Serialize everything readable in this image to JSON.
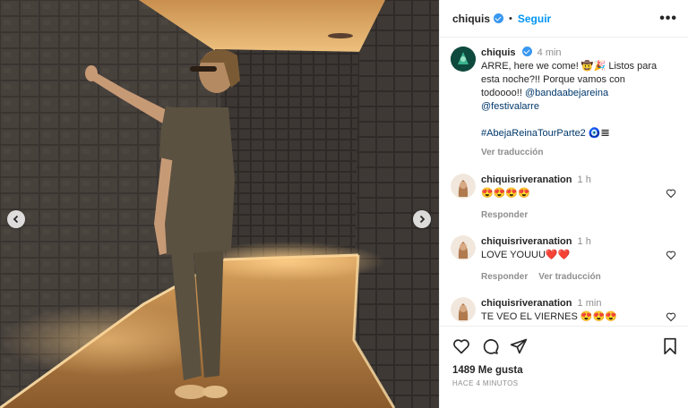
{
  "post": {
    "author": "chiquis",
    "follow_label": "Seguir",
    "more_label": "•••"
  },
  "caption": {
    "user": "chiquis",
    "time": "4 min",
    "text": "ARRE, here we come! 🤠🎉 Listos para esta noche?!! Porque vamos con todoooo!!",
    "mentions": [
      "@bandaabejareina",
      "@festivalarre"
    ],
    "hashtag": "#AbejaReinaTourParte2",
    "hashtag_emoji": "🧿𝌆",
    "translate_label": "Ver traducción"
  },
  "comments": [
    {
      "user": "chiquisriveranation",
      "time": "1 h",
      "text": "😍😍😍😍",
      "actions": [
        "Responder"
      ]
    },
    {
      "user": "chiquisriveranation",
      "time": "1 h",
      "text": "LOVE YOUUU❤️❤️",
      "actions": [
        "Responder",
        "Ver traducción"
      ]
    },
    {
      "user": "chiquisriveranation",
      "time": "1 min",
      "text": "TE VEO EL VIERNES 😍😍😍",
      "actions": []
    }
  ],
  "stats": {
    "likes": "1489 Me gusta",
    "time_ago": "HACE 4 MINUTOS"
  },
  "icons": {
    "like": "heart-icon",
    "comment": "comment-icon",
    "share": "share-icon",
    "save": "bookmark-icon",
    "prev": "chevron-left-icon",
    "next": "chevron-right-icon"
  },
  "colors": {
    "accent": "#0095f6",
    "verified": "#3897f0",
    "link": "#00376b",
    "muted": "#8e8e8e"
  }
}
